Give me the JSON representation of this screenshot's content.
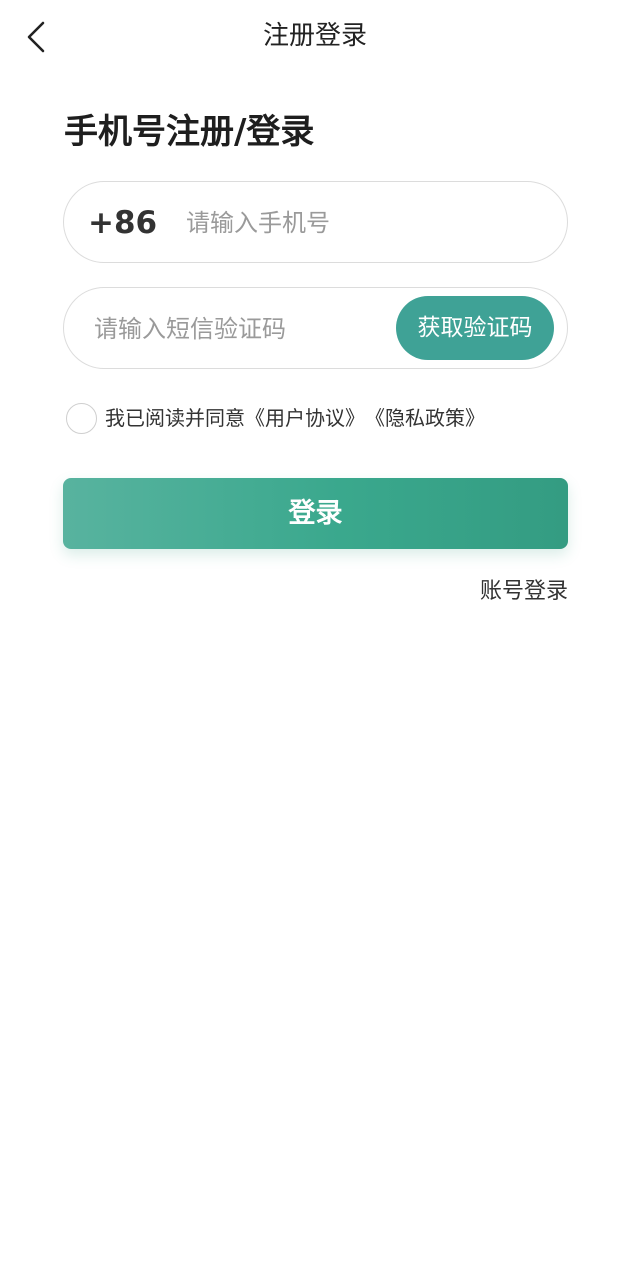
{
  "header": {
    "back_icon": "chevron-left-icon",
    "title": "注册登录"
  },
  "section_title": "手机号注册/登录",
  "phone": {
    "country_code": "+86",
    "placeholder": "请输入手机号",
    "value": ""
  },
  "sms_code": {
    "placeholder": "请输入短信验证码",
    "value": "",
    "get_code_label": "获取验证码"
  },
  "agreement": {
    "checked": false,
    "text": "我已阅读并同意",
    "user_agreement": "《用户协议》",
    "privacy_policy": "《隐私政策》"
  },
  "login_button": "登录",
  "account_login": "账号登录",
  "colors": {
    "accent": "#3fa296",
    "button_gradient_start": "#58b39f",
    "button_gradient_end": "#349c82"
  }
}
